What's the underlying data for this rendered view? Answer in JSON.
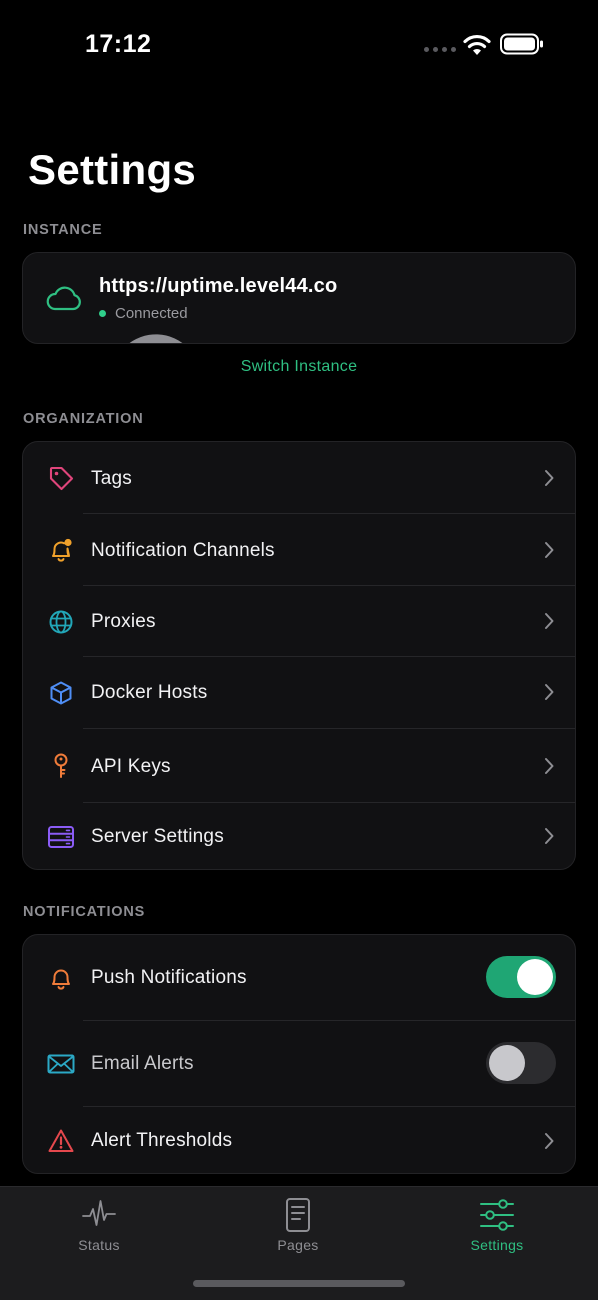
{
  "status_bar": {
    "time": "17:12"
  },
  "page": {
    "title": "Settings"
  },
  "instance": {
    "section_label": "INSTANCE",
    "url": "https://uptime.level44.co",
    "status": "Connected",
    "switch_label": "Switch Instance"
  },
  "organization": {
    "section_label": "ORGANIZATION",
    "items": [
      {
        "label": "Tags",
        "icon": "tag-icon"
      },
      {
        "label": "Notification Channels",
        "icon": "bell-badge-icon"
      },
      {
        "label": "Proxies",
        "icon": "globe-icon"
      },
      {
        "label": "Docker Hosts",
        "icon": "cube-icon"
      },
      {
        "label": "API Keys",
        "icon": "key-icon"
      },
      {
        "label": "Server Settings",
        "icon": "server-icon"
      }
    ]
  },
  "notifications": {
    "section_label": "NOTIFICATIONS",
    "push": {
      "label": "Push Notifications",
      "enabled": true
    },
    "email": {
      "label": "Email Alerts",
      "enabled": false
    },
    "thresholds": {
      "label": "Alert Thresholds"
    }
  },
  "tabs": [
    {
      "label": "Status",
      "icon": "activity-icon",
      "active": false
    },
    {
      "label": "Pages",
      "icon": "document-icon",
      "active": false
    },
    {
      "label": "Settings",
      "icon": "sliders-icon",
      "active": true
    }
  ],
  "colors": {
    "accent": "#2fbf82",
    "toggle_on": "#1fa674",
    "tag": "#e0457b",
    "bell": "#f0a12b",
    "globe": "#22a7b8",
    "cube": "#4f8ef5",
    "key": "#f07c3a",
    "server": "#8b5cf6",
    "mail": "#2ba9c6",
    "warning": "#e5484d"
  }
}
